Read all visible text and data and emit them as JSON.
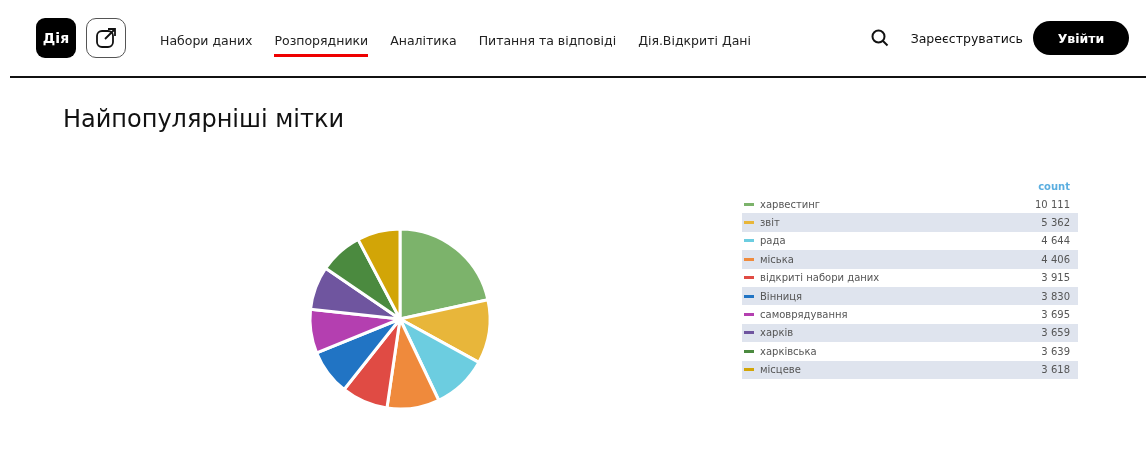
{
  "header": {
    "logo": "Дія",
    "nav": [
      {
        "label": "Набори даних",
        "selected": false
      },
      {
        "label": "Розпорядники",
        "selected": true
      },
      {
        "label": "Аналітика",
        "selected": false
      },
      {
        "label": "Питання та відповіді",
        "selected": false
      },
      {
        "label": "Дія.Відкриті Дані",
        "selected": false
      }
    ],
    "register": "Зареєструватись",
    "login": "Увійти"
  },
  "title": "Найпопулярніші мітки",
  "chart_data": {
    "type": "pie",
    "categories": [
      "харвестинг",
      "звіт",
      "рада",
      "міська",
      "відкриті набори даних",
      "Вінниця",
      "самоврядування",
      "харків",
      "харківська",
      "місцеве"
    ],
    "values": [
      21.57,
      11.44,
      9.91,
      9.4,
      8.35,
      8.17,
      7.88,
      7.81,
      7.76,
      7.71
    ]
  },
  "legend": {
    "column": "count",
    "rows": [
      {
        "count": "10 111",
        "color": "#7cb36b"
      },
      {
        "count": "5 362",
        "color": "#e8b63a"
      },
      {
        "count": "4 644",
        "color": "#6ccde0"
      },
      {
        "count": "4 406",
        "color": "#ef8a3c"
      },
      {
        "count": "3 915",
        "color": "#e04b44"
      },
      {
        "count": "3 830",
        "color": "#2174c4"
      },
      {
        "count": "3 695",
        "color": "#b43fb0"
      },
      {
        "count": "3 659",
        "color": "#6f559f"
      },
      {
        "count": "3 639",
        "color": "#4b8a3f"
      },
      {
        "count": "3 618",
        "color": "#d2a507"
      }
    ]
  }
}
